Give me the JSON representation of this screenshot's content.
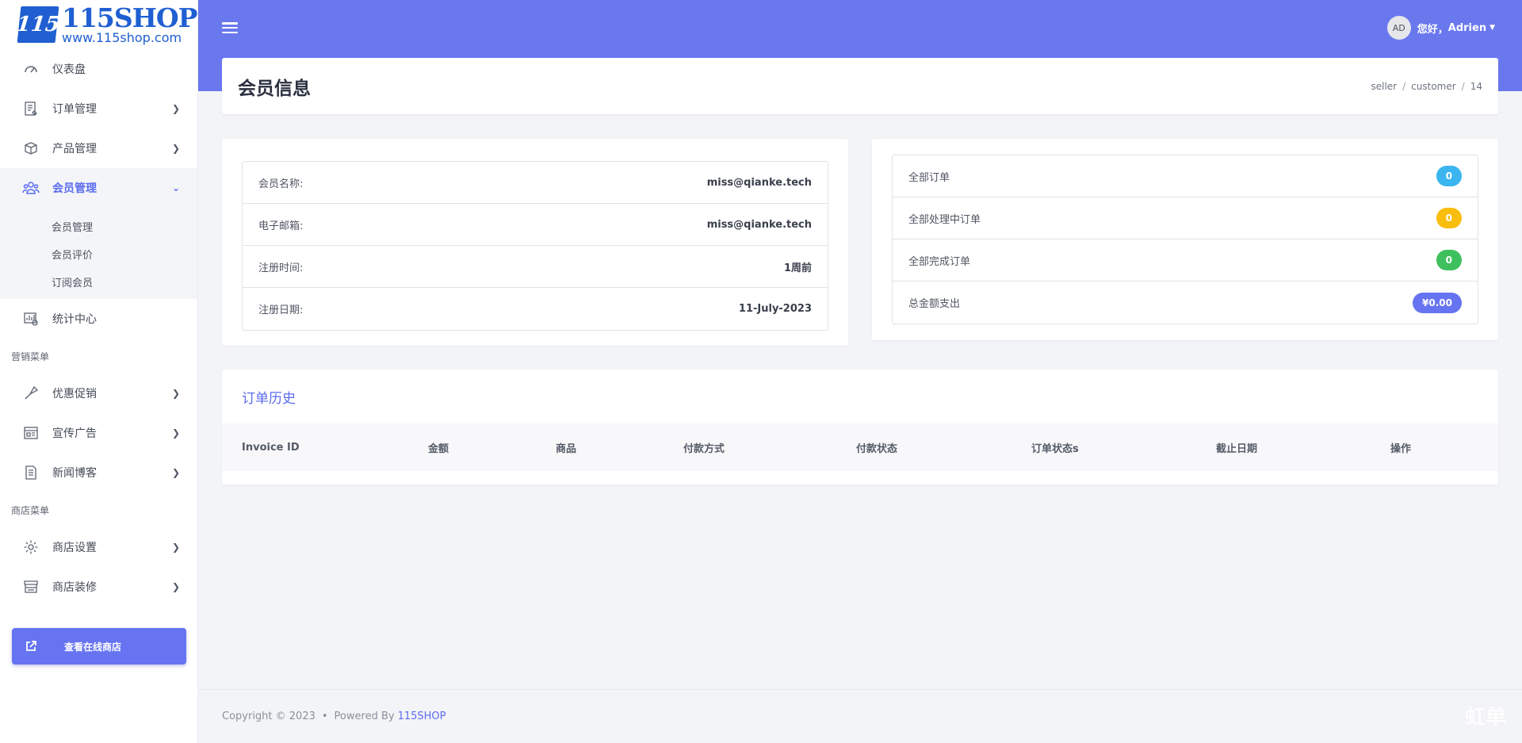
{
  "logo": {
    "mark": "115",
    "brand": "115SHOP",
    "url": "www.115shop.com"
  },
  "sidebar": {
    "items_top": [
      {
        "label": "仪表盘",
        "icon": "dashboard-gauge-icon"
      },
      {
        "label": "订单管理",
        "icon": "order-list-icon"
      },
      {
        "label": "产品管理",
        "icon": "product-box-icon"
      },
      {
        "label": "会员管理",
        "icon": "members-group-icon"
      }
    ],
    "sub_items": [
      "会员管理",
      "会员评价",
      "订阅会员"
    ],
    "item_stats": {
      "label": "统计中心",
      "icon": "statistics-chart-icon"
    },
    "section_marketing": "营销菜单",
    "items_marketing": [
      {
        "label": "优惠促销",
        "icon": "promotion-icon"
      },
      {
        "label": "宣传广告",
        "icon": "advertising-icon"
      },
      {
        "label": "新闻博客",
        "icon": "news-blog-icon"
      }
    ],
    "section_shop": "商店菜单",
    "items_shop": [
      {
        "label": "商店设置",
        "icon": "gear-icon"
      },
      {
        "label": "商店装修",
        "icon": "storefront-icon"
      }
    ],
    "shop_button": "查看在线商店"
  },
  "header": {
    "avatar_initials": "AD",
    "greeting": "您好，",
    "username": "Adrien"
  },
  "page": {
    "title": "会员信息",
    "breadcrumb": [
      "seller",
      "customer",
      "14"
    ]
  },
  "member_info": [
    {
      "key": "会员名称:",
      "value": "miss@qianke.tech"
    },
    {
      "key": "电子邮箱:",
      "value": "miss@qianke.tech"
    },
    {
      "key": "注册时间:",
      "value": "1周前"
    },
    {
      "key": "注册日期:",
      "value": "11-July-2023"
    }
  ],
  "order_stats": [
    {
      "key": "全部订单",
      "value": "0",
      "color": "#3ab5ef"
    },
    {
      "key": "全部处理中订单",
      "value": "0",
      "color": "#f9bd0e"
    },
    {
      "key": "全部完成订单",
      "value": "0",
      "color": "#3fc05e"
    },
    {
      "key": "总金额支出",
      "value": "¥0.00",
      "color": "#6674f1"
    }
  ],
  "order_history": {
    "title": "订单历史",
    "columns": [
      "Invoice ID",
      "金额",
      "商品",
      "付款方式",
      "付款状态",
      "订单状态s",
      "截止日期",
      "操作"
    ]
  },
  "footer": {
    "copyright": "Copyright © 2023",
    "dot": "•",
    "powered": "Powered By",
    "link": "115SHOP"
  },
  "watermark": "虹单"
}
